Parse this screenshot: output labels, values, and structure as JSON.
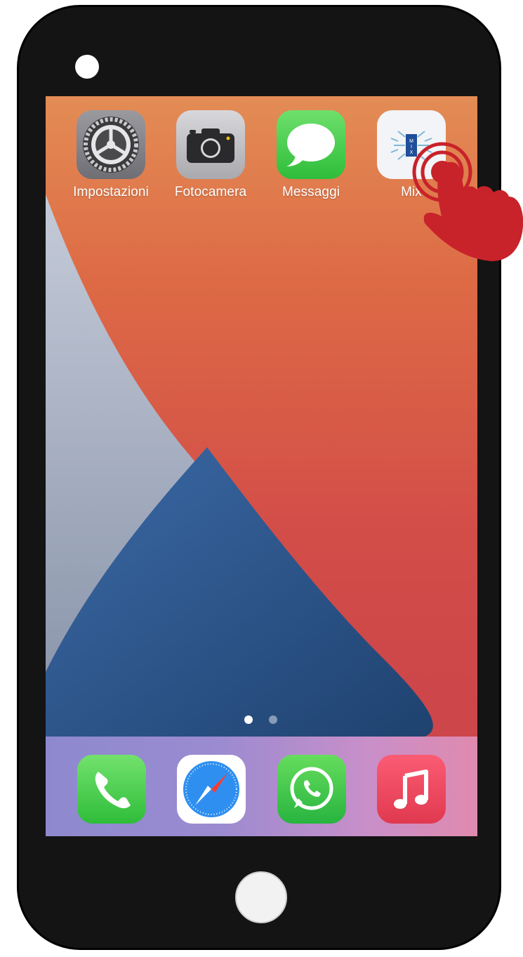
{
  "home_screen": {
    "apps": [
      {
        "label": "Impostazioni",
        "icon": "settings-gear-icon"
      },
      {
        "label": "Fotocamera",
        "icon": "camera-icon"
      },
      {
        "label": "Messaggi",
        "icon": "messages-bubble-icon"
      },
      {
        "label": "Mix",
        "icon": "mix-app-icon",
        "icon_text": "MIX"
      }
    ],
    "page_indicator": {
      "pages": 2,
      "current": 1
    }
  },
  "dock": {
    "apps": [
      {
        "icon": "phone-icon"
      },
      {
        "icon": "safari-compass-icon"
      },
      {
        "icon": "whatsapp-icon"
      },
      {
        "icon": "music-note-icon"
      }
    ]
  },
  "colors": {
    "wallpaper_orange": "#e0784a",
    "wallpaper_red": "#d2464a",
    "wallpaper_blue": "#2f5b90",
    "wallpaper_grey": "#aab3c4",
    "tap_hand": "#c8222a"
  }
}
